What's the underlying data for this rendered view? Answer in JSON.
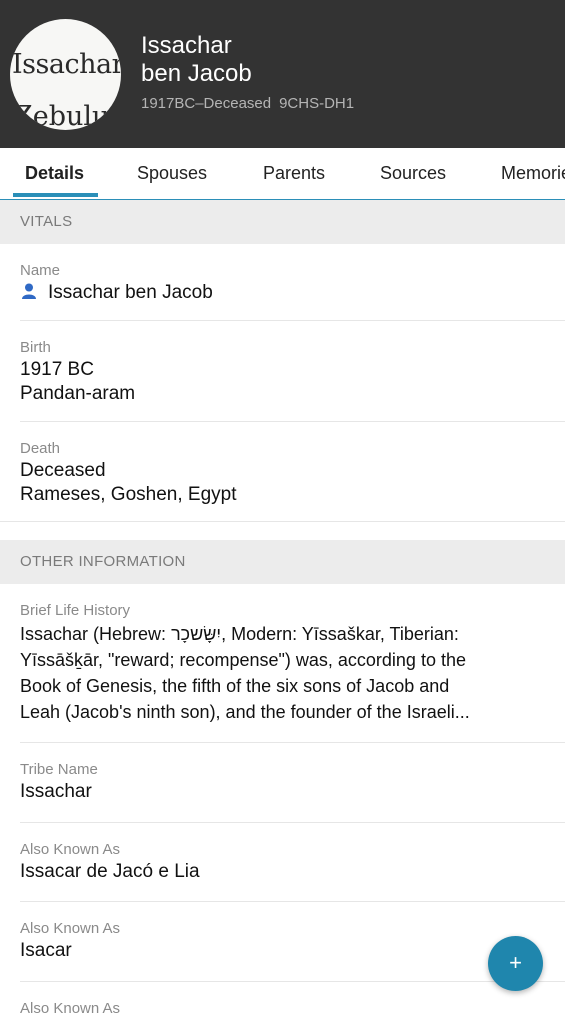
{
  "header": {
    "avatar_text_line1": "Issachar",
    "avatar_text_line2": "Zebulun",
    "name_line1": "Issachar",
    "name_line2": "ben Jacob",
    "lifespan": "1917BC–Deceased",
    "person_id": "9CHS-DH1"
  },
  "tabs": [
    "Details",
    "Spouses",
    "Parents",
    "Sources",
    "Memories"
  ],
  "vitals": {
    "section_title": "VITALS",
    "name_label": "Name",
    "name_value": "Issachar ben Jacob",
    "birth_label": "Birth",
    "birth_date": "1917 BC",
    "birth_place": "Pandan-aram",
    "death_label": "Death",
    "death_date": "Deceased",
    "death_place": "Rameses, Goshen, Egypt"
  },
  "other": {
    "section_title": "OTHER INFORMATION",
    "life_history_label": "Brief Life History",
    "life_history_lines": [
      "Issachar (Hebrew: יִשָּׂשכָר, Modern: Yīssaškar, Tiberian:",
      "Yīssāšḵār, \"reward; recompense\") was, according to the",
      "Book of Genesis, the fifth of the six sons of Jacob and",
      "Leah (Jacob's ninth son), and the founder of the Israeli..."
    ],
    "tribe_label": "Tribe Name",
    "tribe_value": "Issachar",
    "aka_label": "Also Known As",
    "aka_values": [
      "Issacar de Jacó e Lia",
      "Isacar"
    ]
  },
  "fab_label": "+",
  "colors": {
    "header_bg": "#333333",
    "accent": "#2b8fb8",
    "section_bg": "#ececec"
  }
}
